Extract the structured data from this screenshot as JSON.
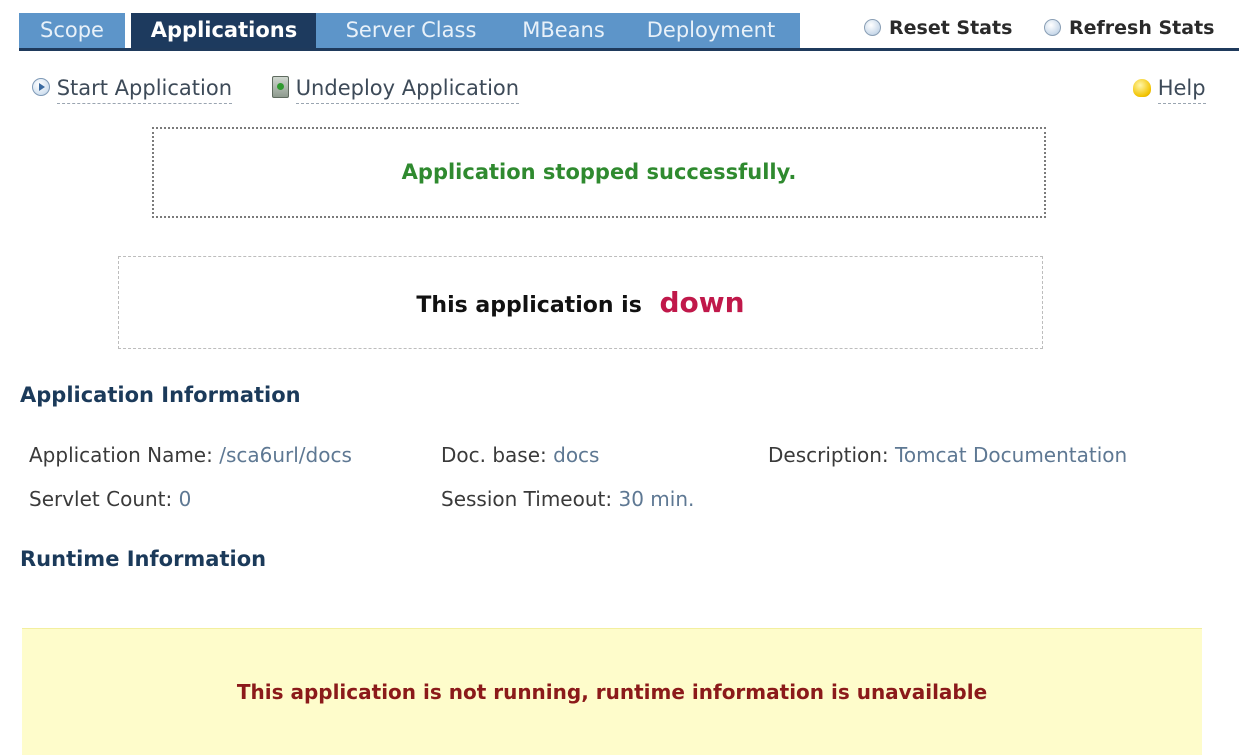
{
  "tabs": [
    {
      "label": "Scope",
      "active": false
    },
    {
      "label": "Applications",
      "active": true
    },
    {
      "label": "Server Class",
      "active": false
    },
    {
      "label": "MBeans",
      "active": false
    },
    {
      "label": "Deployment",
      "active": false
    }
  ],
  "header_actions": {
    "reset_stats": "Reset Stats",
    "refresh_stats": "Refresh Stats"
  },
  "toolbar": {
    "start_application": "Start Application",
    "undeploy_application": "Undeploy Application",
    "help": "Help"
  },
  "messages": {
    "success": "Application stopped successfully.",
    "status_prefix": "This application is",
    "status_value": "down"
  },
  "application_information": {
    "heading": "Application Information",
    "application_name_label": "Application Name:",
    "application_name_value": "/sca6url/docs",
    "doc_base_label": "Doc. base:",
    "doc_base_value": "docs",
    "description_label": "Description:",
    "description_value": "Tomcat Documentation",
    "servlet_count_label": "Servlet Count:",
    "servlet_count_value": "0",
    "session_timeout_label": "Session Timeout:",
    "session_timeout_value": "30 min."
  },
  "runtime_information": {
    "heading": "Runtime Information",
    "notice": "This application is not running, runtime information is unavailable"
  },
  "colors": {
    "tab_inactive": "#5d95c9",
    "tab_active": "#1d3a5e",
    "success_text": "#2f8a2f",
    "status_down": "#c0184a",
    "notice_background": "#fefccb",
    "notice_text": "#8b1a1a"
  }
}
